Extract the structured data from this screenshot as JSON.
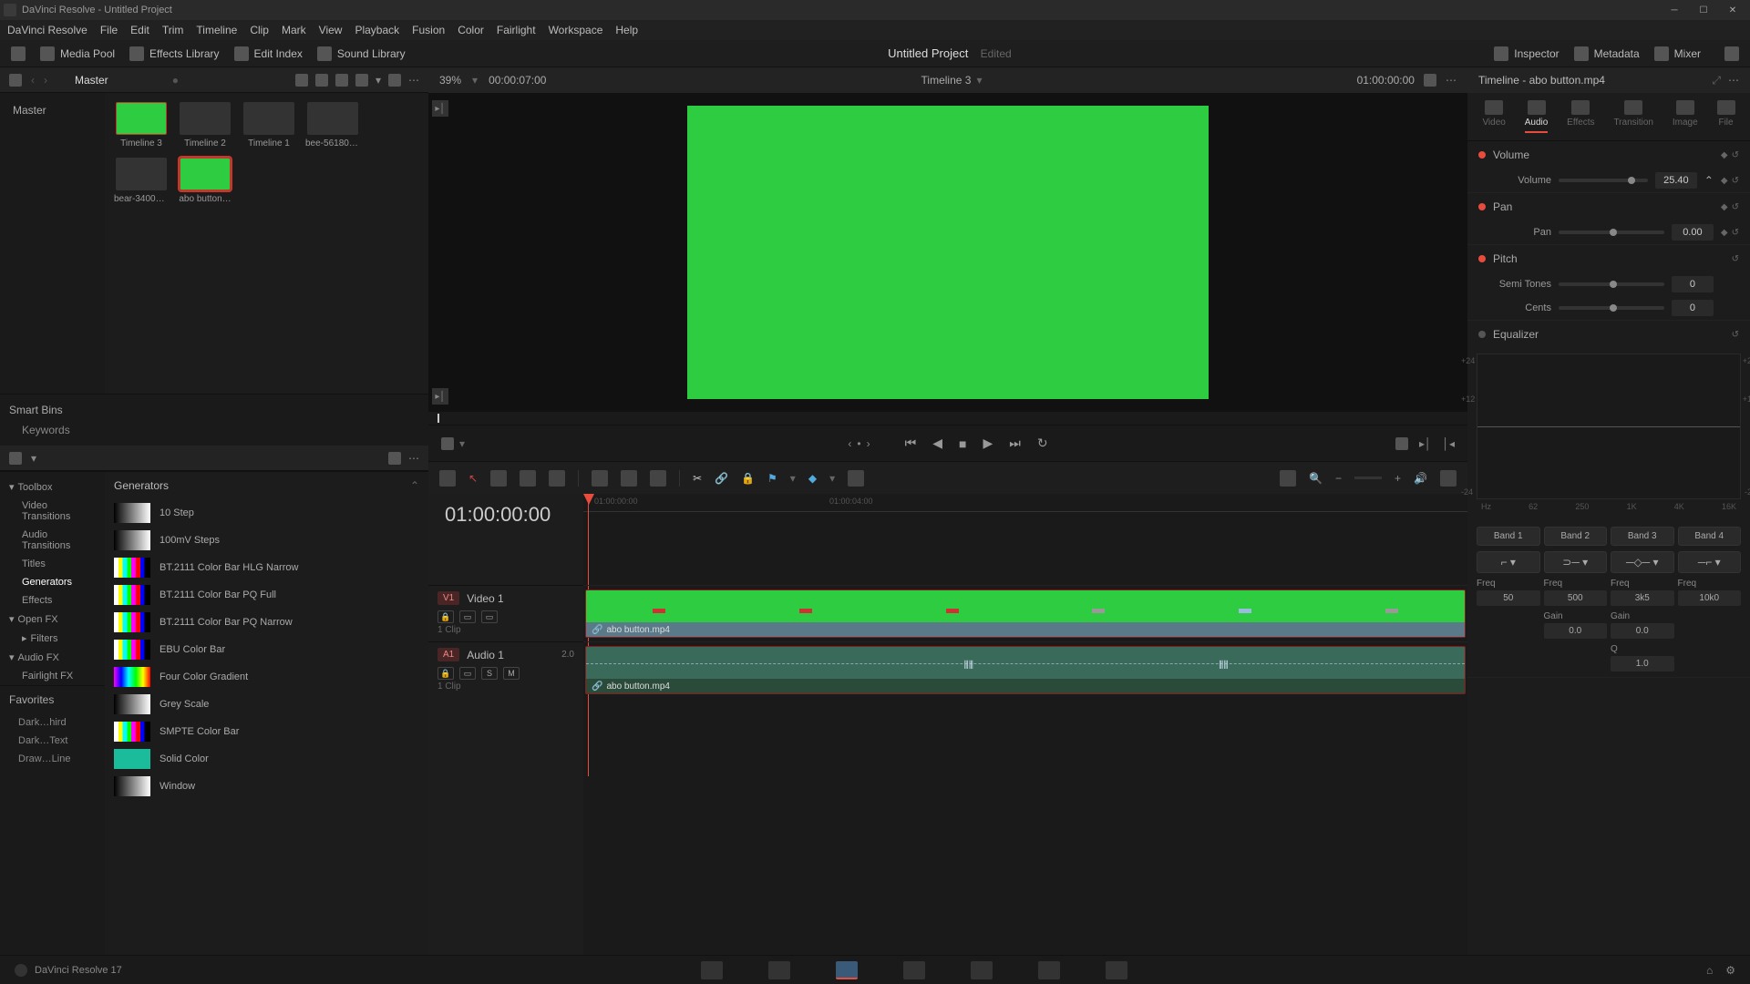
{
  "titlebar": {
    "title": "DaVinci Resolve - Untitled Project"
  },
  "menubar": [
    "DaVinci Resolve",
    "File",
    "Edit",
    "Trim",
    "Timeline",
    "Clip",
    "Mark",
    "View",
    "Playback",
    "Fusion",
    "Color",
    "Fairlight",
    "Workspace",
    "Help"
  ],
  "topToolbar": {
    "left": [
      {
        "name": "media-pool-toggle",
        "label": "Media Pool"
      },
      {
        "name": "effects-library-toggle",
        "label": "Effects Library"
      },
      {
        "name": "edit-index-toggle",
        "label": "Edit Index"
      },
      {
        "name": "sound-library-toggle",
        "label": "Sound Library"
      }
    ],
    "projectTitle": "Untitled Project",
    "projectStatus": "Edited",
    "right": [
      {
        "name": "mixer-toggle",
        "label": "Mixer"
      },
      {
        "name": "metadata-toggle",
        "label": "Metadata"
      },
      {
        "name": "inspector-toggle",
        "label": "Inspector"
      }
    ]
  },
  "pool": {
    "bin": "Master",
    "tree": [
      "Master"
    ],
    "clips": [
      {
        "name": "Timeline 3",
        "kind": "green"
      },
      {
        "name": "Timeline 2",
        "kind": "bw"
      },
      {
        "name": "Timeline 1",
        "kind": "bw"
      },
      {
        "name": "bee-561801…",
        "kind": "bw"
      },
      {
        "name": "bear-34006…",
        "kind": "bw"
      },
      {
        "name": "abo button…",
        "kind": "green",
        "selected": true
      }
    ],
    "smartBinsTitle": "Smart Bins",
    "smartBins": [
      "Keywords"
    ]
  },
  "fx": {
    "treeTop": "Toolbox",
    "tree": [
      "Video Transitions",
      "Audio Transitions",
      "Titles",
      "Generators",
      "Effects"
    ],
    "openfx": "Open FX",
    "openfxSub": [
      "Filters"
    ],
    "audiofx": "Audio FX",
    "audiofxSub": [
      "Fairlight FX"
    ],
    "listHeader": "Generators",
    "items": [
      {
        "name": "10 Step",
        "swatch": "grey"
      },
      {
        "name": "100mV Steps",
        "swatch": "grey"
      },
      {
        "name": "BT.2111 Color Bar HLG Narrow",
        "swatch": "bars"
      },
      {
        "name": "BT.2111 Color Bar PQ Full",
        "swatch": "bars"
      },
      {
        "name": "BT.2111 Color Bar PQ Narrow",
        "swatch": "bars"
      },
      {
        "name": "EBU Color Bar",
        "swatch": "bars"
      },
      {
        "name": "Four Color Gradient",
        "swatch": "grad"
      },
      {
        "name": "Grey Scale",
        "swatch": "grey"
      },
      {
        "name": "SMPTE Color Bar",
        "swatch": "bars"
      },
      {
        "name": "Solid Color",
        "swatch": "solid"
      },
      {
        "name": "Window",
        "swatch": "grey"
      }
    ],
    "favoritesTitle": "Favorites",
    "favorites": [
      "Dark…hird",
      "Dark…Text",
      "Draw…Line"
    ]
  },
  "viewer": {
    "zoom": "39%",
    "tcIn": "00:00:07:00",
    "timeline": "Timeline 3",
    "tcOut": "01:00:00:00"
  },
  "timeline": {
    "tc": "01:00:00:00",
    "videoTrack": {
      "badge": "V1",
      "name": "Video 1",
      "clipCount": "1 Clip",
      "clipName": "abo button.mp4"
    },
    "audioTrack": {
      "badge": "A1",
      "name": "Audio 1",
      "ch": "2.0",
      "clipCount": "1 Clip",
      "clipName": "abo button.mp4"
    }
  },
  "inspector": {
    "title": "Timeline - abo button.mp4",
    "tabs": [
      "Video",
      "Audio",
      "Effects",
      "Transition",
      "Image",
      "File"
    ],
    "activeTab": 1,
    "volume": {
      "title": "Volume",
      "label": "Volume",
      "value": "25.40"
    },
    "pan": {
      "title": "Pan",
      "label": "Pan",
      "value": "0.00"
    },
    "pitch": {
      "title": "Pitch",
      "semi": "Semi Tones",
      "semiVal": "0",
      "cents": "Cents",
      "centsVal": "0"
    },
    "eq": {
      "title": "Equalizer",
      "bands": [
        "Band 1",
        "Band 2",
        "Band 3",
        "Band 4"
      ],
      "freqLabel": "Freq",
      "gainLabel": "Gain",
      "qLabel": "Q",
      "freq": [
        "50",
        "500",
        "3k5",
        "10k0"
      ],
      "gain": [
        "",
        "0.0",
        "0.0",
        ""
      ],
      "q": [
        "",
        "",
        "1.0",
        ""
      ]
    }
  },
  "bottombar": {
    "version": "DaVinci Resolve 17"
  }
}
